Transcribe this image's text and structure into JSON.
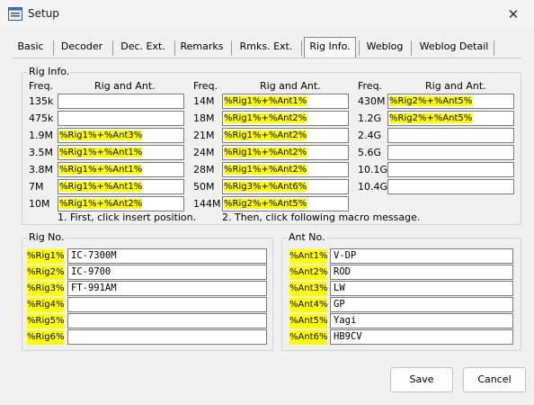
{
  "window": {
    "title": "Setup",
    "close_icon": "close-icon",
    "app_icon": "setup-app-icon"
  },
  "tabs": [
    {
      "label": "Basic"
    },
    {
      "label": "Decoder"
    },
    {
      "label": "Dec. Ext."
    },
    {
      "label": "Remarks"
    },
    {
      "label": "Rmks. Ext."
    },
    {
      "label": "Rig Info."
    },
    {
      "label": "Weblog"
    },
    {
      "label": "Weblog Detail"
    }
  ],
  "active_tab": "Rig Info.",
  "rig_info": {
    "group_label": "Rig Info.",
    "col_freq": "Freq.",
    "col_rig_ant": "Rig and Ant.",
    "columns": [
      {
        "rows": [
          {
            "freq": "135k",
            "value": ""
          },
          {
            "freq": "475k",
            "value": ""
          },
          {
            "freq": "1.9M",
            "value": "%Rig1%+%Ant3%"
          },
          {
            "freq": "3.5M",
            "value": "%Rig1%+%Ant1%"
          },
          {
            "freq": "3.8M",
            "value": "%Rig1%+%Ant1%"
          },
          {
            "freq": "7M",
            "value": "%Rig1%+%Ant1%"
          },
          {
            "freq": "10M",
            "value": "%Rig1%+%Ant2%"
          }
        ]
      },
      {
        "rows": [
          {
            "freq": "14M",
            "value": "%Rig1%+%Ant1%"
          },
          {
            "freq": "18M",
            "value": "%Rig1%+%Ant2%"
          },
          {
            "freq": "21M",
            "value": "%Rig1%+%Ant2%"
          },
          {
            "freq": "24M",
            "value": "%Rig1%+%Ant2%"
          },
          {
            "freq": "28M",
            "value": "%Rig1%+%Ant2%"
          },
          {
            "freq": "50M",
            "value": "%Rig3%+%Ant6%"
          },
          {
            "freq": "144M",
            "value": "%Rig2%+%Ant5%"
          }
        ]
      },
      {
        "rows": [
          {
            "freq": "430M",
            "value": "%Rig2%+%Ant5%"
          },
          {
            "freq": "1.2G",
            "value": "%Rig2%+%Ant5%"
          },
          {
            "freq": "2.4G",
            "value": ""
          },
          {
            "freq": "5.6G",
            "value": ""
          },
          {
            "freq": "10.1G",
            "value": ""
          },
          {
            "freq": "10.4G",
            "value": ""
          }
        ]
      }
    ],
    "hint1": "1. First, click insert position.",
    "hint2": "2. Then, click following macro message."
  },
  "rig_no": {
    "group_label": "Rig No.",
    "items": [
      {
        "tag": "%Rig1%",
        "value": "IC-7300M"
      },
      {
        "tag": "%Rig2%",
        "value": "IC-9700"
      },
      {
        "tag": "%Rig3%",
        "value": "FT-991AM"
      },
      {
        "tag": "%Rig4%",
        "value": ""
      },
      {
        "tag": "%Rig5%",
        "value": ""
      },
      {
        "tag": "%Rig6%",
        "value": ""
      }
    ]
  },
  "ant_no": {
    "group_label": "Ant No.",
    "items": [
      {
        "tag": "%Ant1%",
        "value": "V-DP"
      },
      {
        "tag": "%Ant2%",
        "value": "ROD"
      },
      {
        "tag": "%Ant3%",
        "value": "LW"
      },
      {
        "tag": "%Ant4%",
        "value": "GP"
      },
      {
        "tag": "%Ant5%",
        "value": "Yagi"
      },
      {
        "tag": "%Ant6%",
        "value": "HB9CV"
      }
    ]
  },
  "buttons": {
    "save": "Save",
    "cancel": "Cancel"
  },
  "colors": {
    "highlight": "#ffff00"
  }
}
